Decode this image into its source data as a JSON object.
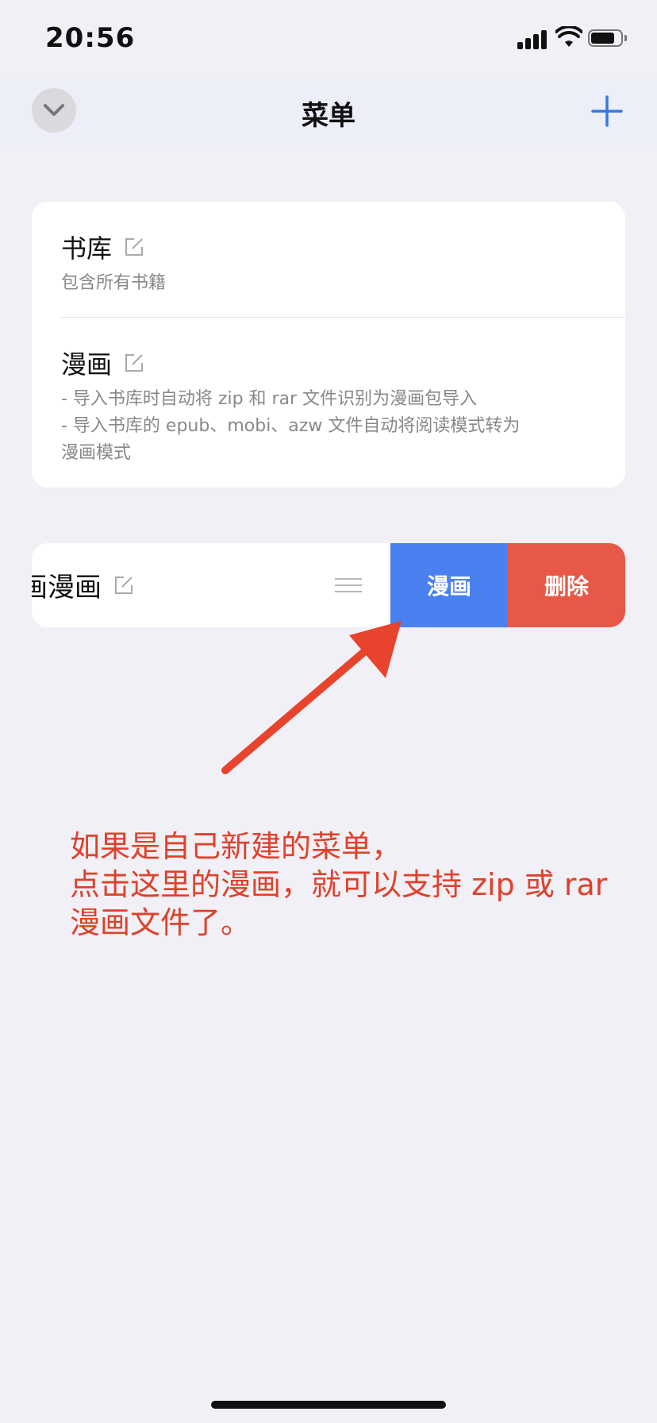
{
  "status_bar": {
    "time": "20:56"
  },
  "nav": {
    "title": "菜单"
  },
  "menu_card": {
    "items": [
      {
        "title": "书库",
        "description": "包含所有书籍"
      },
      {
        "title": "漫画",
        "description": "- 导入书库时自动将 zip 和 rar 文件识别为漫画包导入\n- 导入书库的 epub、mobi、azw 文件自动将阅读模式转为\n漫画模式"
      }
    ]
  },
  "custom_menu": {
    "title": "画漫画",
    "actions": {
      "comic": "漫画",
      "delete": "删除"
    }
  },
  "annotation": {
    "text": "如果是自己新建的菜单，\n点击这里的漫画，就可以支持 zip 或 rar\n漫画文件了。",
    "color": "#e0412a"
  },
  "colors": {
    "comic_action": "#4a80ef",
    "delete_action": "#e85848",
    "accent": "#3a78e0"
  }
}
